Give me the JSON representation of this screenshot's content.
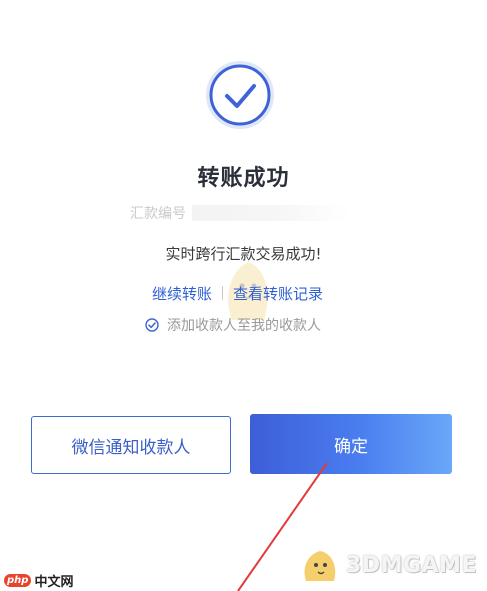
{
  "result": {
    "title": "转账成功",
    "reference_label": "汇款编号",
    "message": "实时跨行汇款交易成功!"
  },
  "links": {
    "continue_transfer": "继续转账",
    "view_records": "查看转账记录"
  },
  "checkbox": {
    "label": "添加收款人至我的收款人",
    "checked": true
  },
  "buttons": {
    "notify_label": "微信通知收款人",
    "confirm_label": "确定"
  },
  "watermarks": {
    "php_mark": "php",
    "php_text": "中文网",
    "brand_3dm": "3DMGAME"
  },
  "colors": {
    "accent": "#3e6ad1",
    "link": "#2f5fd4",
    "annotation_arrow": "#e23b3b"
  }
}
